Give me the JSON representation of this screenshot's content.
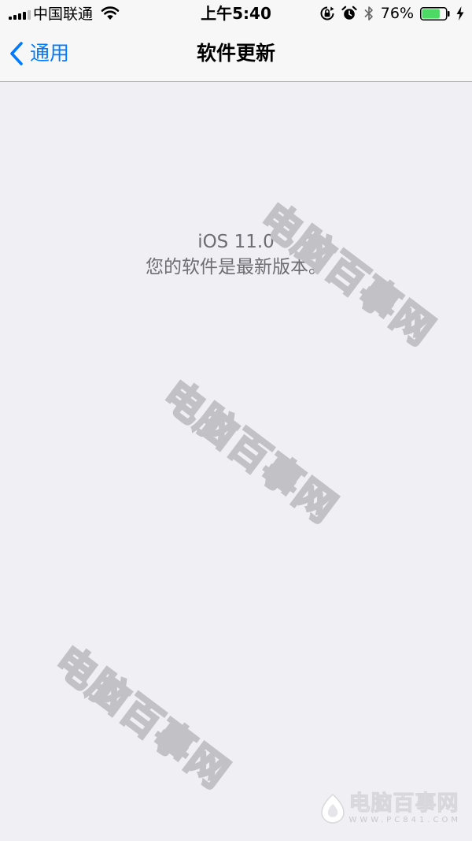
{
  "status_bar": {
    "carrier": "中国联通",
    "time": "上午5:40",
    "battery_percent": "76%",
    "battery_level": 0.76,
    "icons": [
      "signal-icon",
      "wifi-icon",
      "rotation-lock-icon",
      "alarm-icon",
      "bluetooth-icon",
      "battery-icon",
      "charging-icon"
    ]
  },
  "nav": {
    "back_label": "通用",
    "title": "软件更新"
  },
  "content": {
    "ios_version": "iOS 11.0",
    "status_message": "您的软件是最新版本。"
  },
  "watermark": {
    "text": "电脑百事网"
  },
  "logo": {
    "text": "电脑百事网",
    "url": "WWW.PC841.COM"
  },
  "colors": {
    "accent": "#007aff",
    "background": "#efeff4",
    "bar_background": "#f7f7f7",
    "battery_fill": "#4cd964",
    "secondary_text": "#6d6d72"
  }
}
